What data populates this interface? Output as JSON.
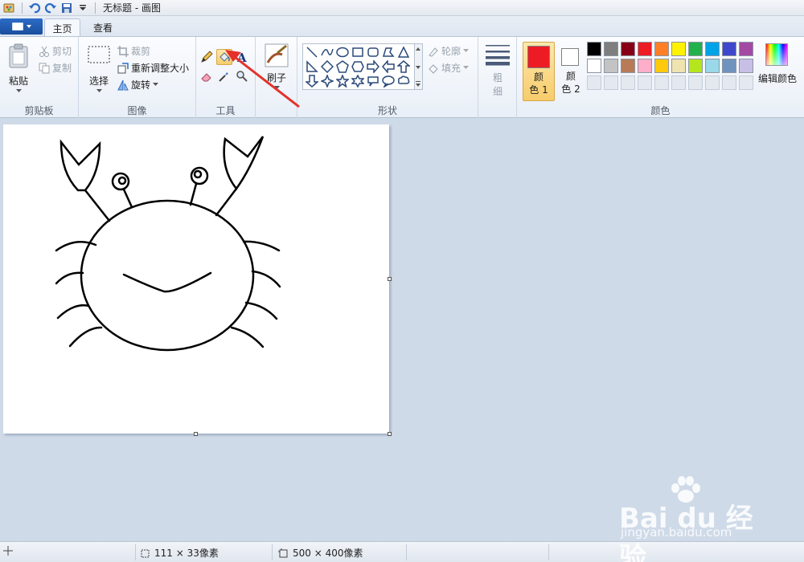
{
  "window": {
    "title": "无标题 - 画图"
  },
  "tabs": {
    "home": "主页",
    "view": "查看"
  },
  "clipboard": {
    "paste": "粘贴",
    "cut": "剪切",
    "copy": "复制",
    "label": "剪贴板"
  },
  "image": {
    "select": "选择",
    "crop": "裁剪",
    "resize": "重新调整大小",
    "rotate": "旋转",
    "label": "图像"
  },
  "tools": {
    "label": "工具"
  },
  "brushes": {
    "label": "刷子"
  },
  "shapes": {
    "outline": "轮廓",
    "fill": "填充",
    "label": "形状"
  },
  "size": {
    "label1": "粗",
    "label2": "细"
  },
  "colors": {
    "color1_l1": "颜",
    "color1_l2": "色 1",
    "color2_l1": "颜",
    "color2_l2": "色 2",
    "edit": "编辑颜色",
    "label": "颜色",
    "color1": "#ed1c24",
    "color2": "#ffffff",
    "row1": [
      "#000000",
      "#7f7f7f",
      "#880015",
      "#ed1c24",
      "#ff7f27",
      "#fff200",
      "#22b14c",
      "#00a2e8",
      "#3f48cc",
      "#a349a4"
    ],
    "row2": [
      "#ffffff",
      "#c3c3c3",
      "#b97a57",
      "#ffaec9",
      "#ffc90e",
      "#efe4b0",
      "#b5e61d",
      "#99d9ea",
      "#7092be",
      "#c8bfe7"
    ]
  },
  "status": {
    "selection": "111 × 33像素",
    "canvas_size": "500 × 400像素"
  },
  "watermark": {
    "line1": "Bai du 经验",
    "line2": "jingyan.baidu.com"
  }
}
